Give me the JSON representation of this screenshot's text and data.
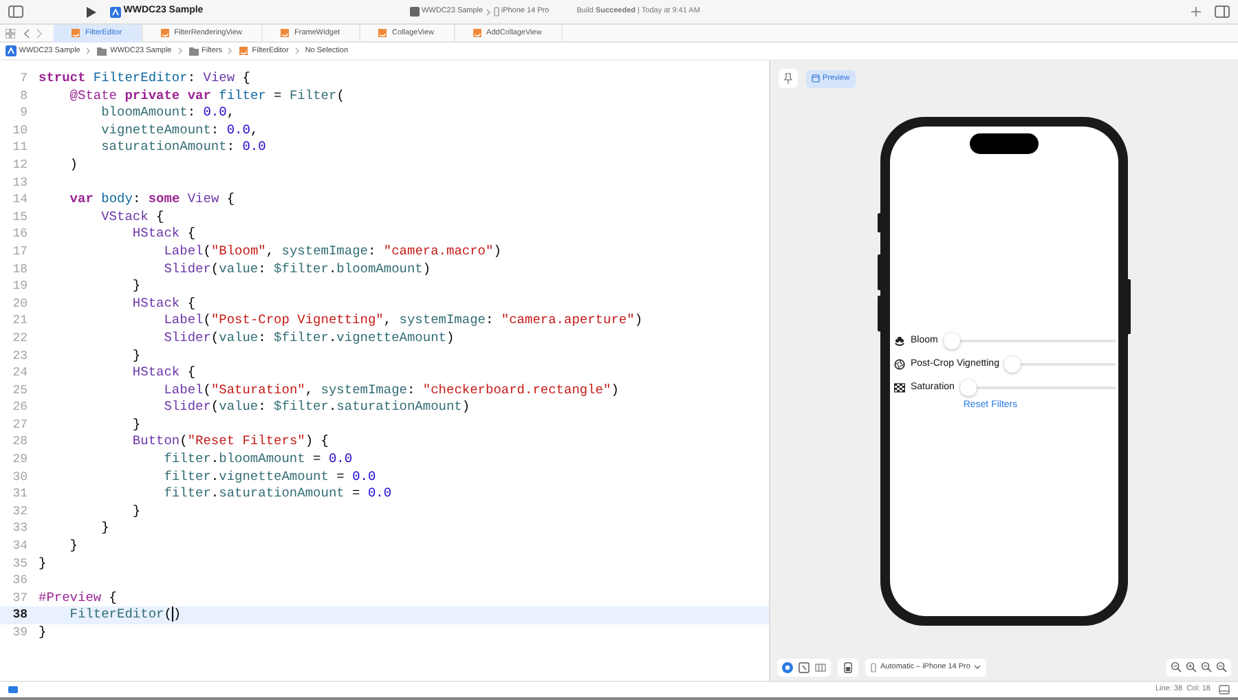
{
  "toolbar": {
    "project": "WWDC23 Sample",
    "scheme": "WWDC23 Sample",
    "device": "iPhone 14 Pro",
    "status": "Build **Succeeded** | Today at 9:41 AM"
  },
  "tabs": [
    {
      "label": "FilterEditor",
      "selected": true
    },
    {
      "label": "FilterRenderingView",
      "selected": false
    },
    {
      "label": "FrameWidget",
      "selected": false
    },
    {
      "label": "CollageView",
      "selected": false
    },
    {
      "label": "AddCollageView",
      "selected": false
    }
  ],
  "breadcrumb": [
    {
      "kind": "project",
      "label": "WWDC23 Sample"
    },
    {
      "kind": "folder",
      "label": "WWDC23 Sample"
    },
    {
      "kind": "folder",
      "label": "Filters"
    },
    {
      "kind": "file",
      "label": "FilterEditor"
    },
    {
      "kind": "plain",
      "label": "No Selection"
    }
  ],
  "editor": {
    "lines": [
      {
        "number": "7",
        "current": false,
        "tokens": [
          {
            "kind": "kw",
            "text": "struct"
          },
          {
            "kind": "decl",
            "text": " FilterEditor"
          },
          {
            "kind": "plain",
            "text": ": "
          },
          {
            "kind": "type",
            "text": "View"
          },
          {
            "kind": "plain",
            "text": " {"
          }
        ]
      },
      {
        "number": "8",
        "current": false,
        "tokens": [
          {
            "kind": "attr",
            "text": "    @State"
          },
          {
            "kind": "kw",
            "text": " private var"
          },
          {
            "kind": "decl",
            "text": " filter"
          },
          {
            "kind": "plain",
            "text": " = "
          },
          {
            "kind": "proj",
            "text": "Filter"
          },
          {
            "kind": "plain",
            "text": "("
          }
        ]
      },
      {
        "number": "9",
        "current": false,
        "tokens": [
          {
            "kind": "prop",
            "text": "        bloomAmount"
          },
          {
            "kind": "plain",
            "text": ": "
          },
          {
            "kind": "num",
            "text": "0.0"
          },
          {
            "kind": "plain",
            "text": ","
          }
        ]
      },
      {
        "number": "10",
        "current": false,
        "tokens": [
          {
            "kind": "prop",
            "text": "        vignetteAmount"
          },
          {
            "kind": "plain",
            "text": ": "
          },
          {
            "kind": "num",
            "text": "0.0"
          },
          {
            "kind": "plain",
            "text": ","
          }
        ]
      },
      {
        "number": "11",
        "current": false,
        "tokens": [
          {
            "kind": "prop",
            "text": "        saturationAmount"
          },
          {
            "kind": "plain",
            "text": ": "
          },
          {
            "kind": "num",
            "text": "0.0"
          }
        ]
      },
      {
        "number": "12",
        "current": false,
        "tokens": [
          {
            "kind": "plain",
            "text": "    )"
          }
        ]
      },
      {
        "number": "13",
        "current": false
      },
      {
        "number": "14",
        "current": false,
        "tokens": [
          {
            "kind": "kw",
            "text": "    var"
          },
          {
            "kind": "decl",
            "text": " body"
          },
          {
            "kind": "plain",
            "text": ": "
          },
          {
            "kind": "kw",
            "text": "some"
          },
          {
            "kind": "type",
            "text": " View"
          },
          {
            "kind": "plain",
            "text": " {"
          }
        ]
      },
      {
        "number": "15",
        "current": false,
        "tokens": [
          {
            "kind": "type",
            "text": "        VStack"
          },
          {
            "kind": "plain",
            "text": " {"
          }
        ]
      },
      {
        "number": "16",
        "current": false,
        "tokens": [
          {
            "kind": "type",
            "text": "            HStack"
          },
          {
            "kind": "plain",
            "text": " {"
          }
        ]
      },
      {
        "number": "17",
        "current": false,
        "tokens": [
          {
            "kind": "type",
            "text": "                Label"
          },
          {
            "kind": "plain",
            "text": "("
          },
          {
            "kind": "str",
            "text": "\"Bloom\""
          },
          {
            "kind": "plain",
            "text": ", "
          },
          {
            "kind": "func",
            "text": "systemImage"
          },
          {
            "kind": "plain",
            "text": ": "
          },
          {
            "kind": "str",
            "text": "\"camera.macro\""
          },
          {
            "kind": "plain",
            "text": ")"
          }
        ]
      },
      {
        "number": "18",
        "current": false,
        "tokens": [
          {
            "kind": "type",
            "text": "                Slider"
          },
          {
            "kind": "plain",
            "text": "("
          },
          {
            "kind": "func",
            "text": "value"
          },
          {
            "kind": "plain",
            "text": ": "
          },
          {
            "kind": "prop",
            "text": "$filter"
          },
          {
            "kind": "plain",
            "text": "."
          },
          {
            "kind": "prop",
            "text": "bloomAmount"
          },
          {
            "kind": "plain",
            "text": ")"
          }
        ]
      },
      {
        "number": "19",
        "current": false,
        "tokens": [
          {
            "kind": "plain",
            "text": "            }"
          }
        ]
      },
      {
        "number": "20",
        "current": false,
        "tokens": [
          {
            "kind": "type",
            "text": "            HStack"
          },
          {
            "kind": "plain",
            "text": " {"
          }
        ]
      },
      {
        "number": "21",
        "current": false,
        "tokens": [
          {
            "kind": "type",
            "text": "                Label"
          },
          {
            "kind": "plain",
            "text": "("
          },
          {
            "kind": "str",
            "text": "\"Post-Crop Vignetting\""
          },
          {
            "kind": "plain",
            "text": ", "
          },
          {
            "kind": "func",
            "text": "systemImage"
          },
          {
            "kind": "plain",
            "text": ": "
          },
          {
            "kind": "str",
            "text": "\"camera.aperture\""
          },
          {
            "kind": "plain",
            "text": ")"
          }
        ]
      },
      {
        "number": "22",
        "current": false,
        "tokens": [
          {
            "kind": "type",
            "text": "                Slider"
          },
          {
            "kind": "plain",
            "text": "("
          },
          {
            "kind": "func",
            "text": "value"
          },
          {
            "kind": "plain",
            "text": ": "
          },
          {
            "kind": "prop",
            "text": "$filter"
          },
          {
            "kind": "plain",
            "text": "."
          },
          {
            "kind": "prop",
            "text": "vignetteAmount"
          },
          {
            "kind": "plain",
            "text": ")"
          }
        ]
      },
      {
        "number": "23",
        "current": false,
        "tokens": [
          {
            "kind": "plain",
            "text": "            }"
          }
        ]
      },
      {
        "number": "24",
        "current": false,
        "tokens": [
          {
            "kind": "type",
            "text": "            HStack"
          },
          {
            "kind": "plain",
            "text": " {"
          }
        ]
      },
      {
        "number": "25",
        "current": false,
        "tokens": [
          {
            "kind": "type",
            "text": "                Label"
          },
          {
            "kind": "plain",
            "text": "("
          },
          {
            "kind": "str",
            "text": "\"Saturation\""
          },
          {
            "kind": "plain",
            "text": ", "
          },
          {
            "kind": "func",
            "text": "systemImage"
          },
          {
            "kind": "plain",
            "text": ": "
          },
          {
            "kind": "str",
            "text": "\"checkerboard.rectangle\""
          },
          {
            "kind": "plain",
            "text": ")"
          }
        ]
      },
      {
        "number": "26",
        "current": false,
        "tokens": [
          {
            "kind": "type",
            "text": "                Slider"
          },
          {
            "kind": "plain",
            "text": "("
          },
          {
            "kind": "func",
            "text": "value"
          },
          {
            "kind": "plain",
            "text": ": "
          },
          {
            "kind": "prop",
            "text": "$filter"
          },
          {
            "kind": "plain",
            "text": "."
          },
          {
            "kind": "prop",
            "text": "saturationAmount"
          },
          {
            "kind": "plain",
            "text": ")"
          }
        ]
      },
      {
        "number": "27",
        "current": false,
        "tokens": [
          {
            "kind": "plain",
            "text": "            }"
          }
        ]
      },
      {
        "number": "28",
        "current": false,
        "tokens": [
          {
            "kind": "type",
            "text": "            Button"
          },
          {
            "kind": "plain",
            "text": "("
          },
          {
            "kind": "str",
            "text": "\"Reset Filters\""
          },
          {
            "kind": "plain",
            "text": ") {"
          }
        ]
      },
      {
        "number": "29",
        "current": false,
        "tokens": [
          {
            "kind": "prop",
            "text": "                filter"
          },
          {
            "kind": "plain",
            "text": "."
          },
          {
            "kind": "prop",
            "text": "bloomAmount"
          },
          {
            "kind": "plain",
            "text": " = "
          },
          {
            "kind": "num",
            "text": "0.0"
          }
        ]
      },
      {
        "number": "30",
        "current": false,
        "tokens": [
          {
            "kind": "prop",
            "text": "                filter"
          },
          {
            "kind": "plain",
            "text": "."
          },
          {
            "kind": "prop",
            "text": "vignetteAmount"
          },
          {
            "kind": "plain",
            "text": " = "
          },
          {
            "kind": "num",
            "text": "0.0"
          }
        ]
      },
      {
        "number": "31",
        "current": false,
        "tokens": [
          {
            "kind": "prop",
            "text": "                filter"
          },
          {
            "kind": "plain",
            "text": "."
          },
          {
            "kind": "prop",
            "text": "saturationAmount"
          },
          {
            "kind": "plain",
            "text": " = "
          },
          {
            "kind": "num",
            "text": "0.0"
          }
        ]
      },
      {
        "number": "32",
        "current": false,
        "tokens": [
          {
            "kind": "plain",
            "text": "            }"
          }
        ]
      },
      {
        "number": "33",
        "current": false,
        "tokens": [
          {
            "kind": "plain",
            "text": "        }"
          }
        ]
      },
      {
        "number": "34",
        "current": false,
        "tokens": [
          {
            "kind": "plain",
            "text": "    }"
          }
        ]
      },
      {
        "number": "35",
        "current": false,
        "tokens": [
          {
            "kind": "plain",
            "text": "}"
          }
        ]
      },
      {
        "number": "36",
        "current": false
      },
      {
        "number": "37",
        "current": false,
        "tokens": [
          {
            "kind": "attr",
            "text": "#Preview"
          },
          {
            "kind": "plain",
            "text": " {"
          }
        ]
      },
      {
        "number": "38",
        "current": true,
        "tokens": [
          {
            "kind": "proj",
            "text": "    FilterEditor"
          },
          {
            "kind": "plain",
            "text": "("
          },
          {
            "kind": "cursor"
          },
          {
            "kind": "plain",
            "text": ")"
          }
        ]
      },
      {
        "number": "39",
        "current": false,
        "tokens": [
          {
            "kind": "plain",
            "text": "}"
          }
        ]
      }
    ]
  },
  "preview": {
    "preview_button": {
      "label": "Preview",
      "selected": true
    },
    "rows": [
      {
        "kind": "macro",
        "label": "Bloom",
        "level": 0
      },
      {
        "kind": "aperture",
        "label": "Post-Crop Vignetting",
        "level": 0
      },
      {
        "kind": "checkerboard",
        "label": "Saturation",
        "level": 0
      }
    ],
    "reset_button": "Reset Filters",
    "modes": [
      {
        "kind": "live",
        "selected": true
      },
      {
        "kind": "selectable",
        "selected": false
      },
      {
        "kind": "variants",
        "selected": false
      }
    ],
    "device_menu": "Automatic – iPhone 14 Pro"
  },
  "status_bar": {
    "position": "Line: 38  Col: 18"
  }
}
